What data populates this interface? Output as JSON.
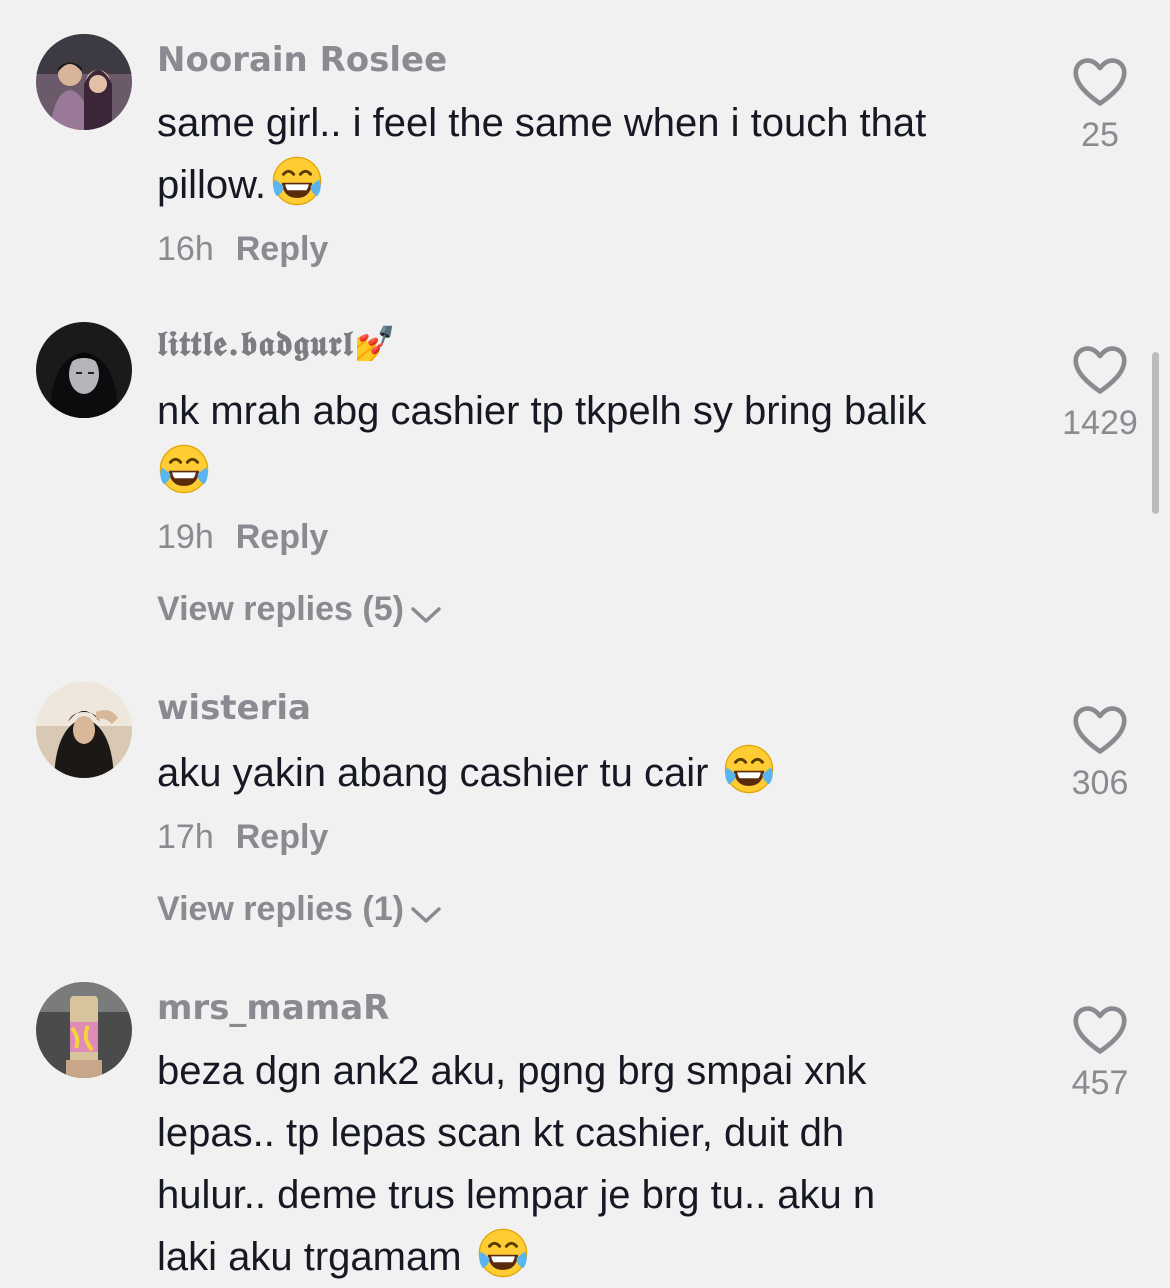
{
  "comments": [
    {
      "username": "Noorain Roslee",
      "text_line1": "same girl.. i feel the same when i touch that",
      "text_line2": "pillow.",
      "time": "16h",
      "reply_label": "Reply",
      "likes": "25"
    },
    {
      "username": "𝖑𝖎𝖙𝖙𝖑𝖊.𝖇𝖆𝖉𝖌𝖚𝖗𝖑💅",
      "text_line1": "nk mrah abg cashier tp tkpelh sy bring balik",
      "text_line2": "",
      "time": "19h",
      "reply_label": "Reply",
      "view_replies": "View replies (5)",
      "likes": "1429"
    },
    {
      "username": "wisteria",
      "text_line1": "aku yakin abang cashier tu cair",
      "time": "17h",
      "reply_label": "Reply",
      "view_replies": "View replies (1)",
      "likes": "306"
    },
    {
      "username": "mrs_mamaR",
      "text_line1": "beza dgn ank2 aku, pgng brg smpai xnk",
      "text_line2": "lepas.. tp lepas scan kt cashier, duit dh",
      "text_line3": "hulur.. deme trus lempar je brg tu.. aku n",
      "text_line4": "laki aku trgamam",
      "likes": "457"
    }
  ],
  "icons": {
    "like": "heart-outline-icon",
    "emoji": "face-with-tears-of-joy-emoji",
    "chevron": "chevron-down-icon"
  },
  "colors": {
    "background": "#f1f1f1",
    "muted_text": "#8a8b91",
    "primary_text": "#161823"
  }
}
